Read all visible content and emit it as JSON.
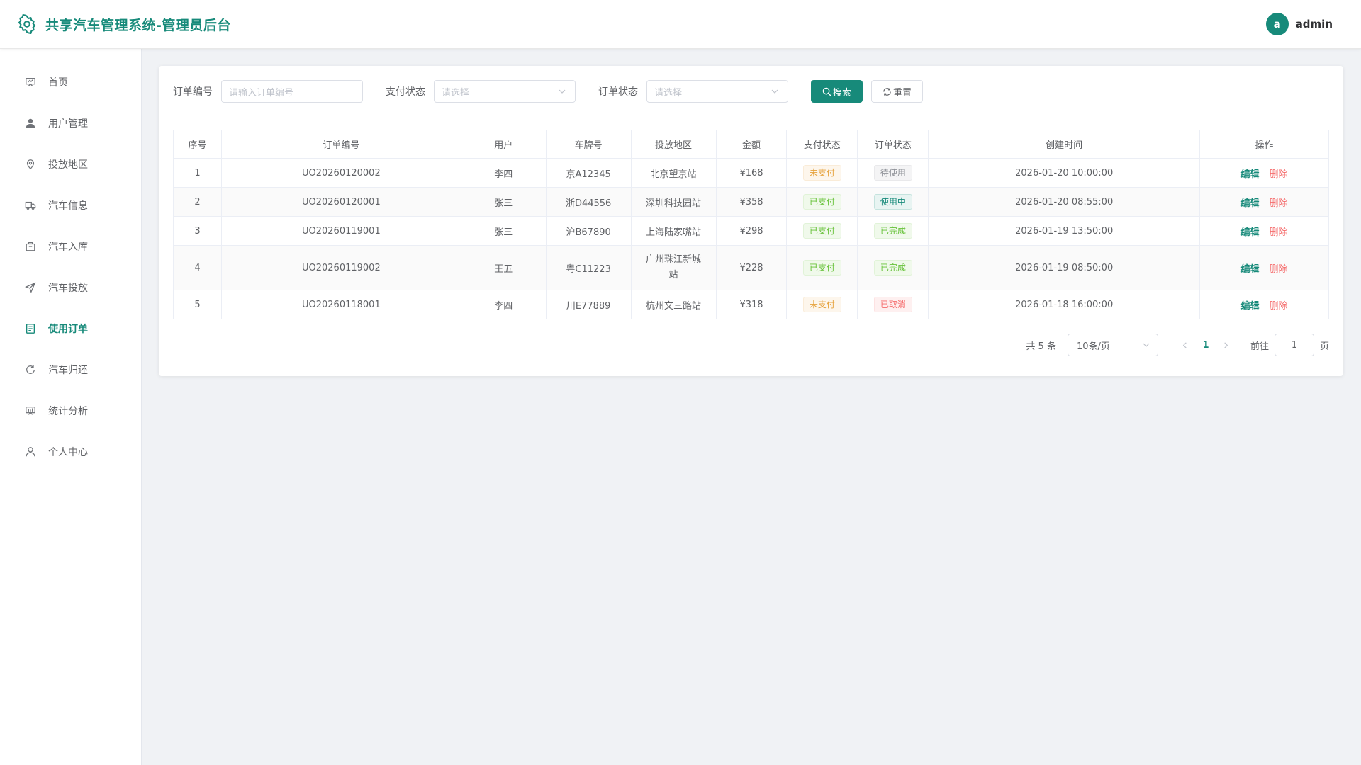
{
  "header": {
    "title": "共享汽车管理系统-管理员后台",
    "avatar_letter": "a",
    "username": "admin"
  },
  "sidebar": {
    "items": [
      {
        "label": "首页",
        "icon": "dashboard-icon"
      },
      {
        "label": "用户管理",
        "icon": "user-icon"
      },
      {
        "label": "投放地区",
        "icon": "location-icon"
      },
      {
        "label": "汽车信息",
        "icon": "truck-icon"
      },
      {
        "label": "汽车入库",
        "icon": "box-icon"
      },
      {
        "label": "汽车投放",
        "icon": "send-icon"
      },
      {
        "label": "使用订单",
        "icon": "document-icon"
      },
      {
        "label": "汽车归还",
        "icon": "refresh-icon"
      },
      {
        "label": "统计分析",
        "icon": "chart-icon"
      },
      {
        "label": "个人中心",
        "icon": "user-outline-icon"
      }
    ],
    "active_index": 6
  },
  "filters": {
    "order_no_label": "订单编号",
    "order_no_placeholder": "请输入订单编号",
    "pay_status_label": "支付状态",
    "pay_status_placeholder": "请选择",
    "order_status_label": "订单状态",
    "order_status_placeholder": "请选择",
    "search_label": "搜索",
    "reset_label": "重置"
  },
  "table": {
    "headers": [
      "序号",
      "订单编号",
      "用户",
      "车牌号",
      "投放地区",
      "金额",
      "支付状态",
      "订单状态",
      "创建时间",
      "操作"
    ],
    "rows": [
      {
        "idx": "1",
        "order_no": "UO20260120002",
        "user": "李四",
        "plate": "京A12345",
        "region": "北京望京站",
        "amount": "¥168",
        "pay": "未支付",
        "status": "待使用",
        "created": "2026-01-20 10:00:00"
      },
      {
        "idx": "2",
        "order_no": "UO20260120001",
        "user": "张三",
        "plate": "浙D44556",
        "region": "深圳科技园站",
        "amount": "¥358",
        "pay": "已支付",
        "status": "使用中",
        "created": "2026-01-20 08:55:00"
      },
      {
        "idx": "3",
        "order_no": "UO20260119001",
        "user": "张三",
        "plate": "沪B67890",
        "region": "上海陆家嘴站",
        "amount": "¥298",
        "pay": "已支付",
        "status": "已完成",
        "created": "2026-01-19 13:50:00"
      },
      {
        "idx": "4",
        "order_no": "UO20260119002",
        "user": "王五",
        "plate": "粤C11223",
        "region": "广州珠江新城站",
        "amount": "¥228",
        "pay": "已支付",
        "status": "已完成",
        "created": "2026-01-19 08:50:00"
      },
      {
        "idx": "5",
        "order_no": "UO20260118001",
        "user": "李四",
        "plate": "川E77889",
        "region": "杭州文三路站",
        "amount": "¥318",
        "pay": "未支付",
        "status": "已取消",
        "created": "2026-01-18 16:00:00"
      }
    ],
    "edit_label": "编辑",
    "delete_label": "删除"
  },
  "pagination": {
    "total_text": "共 5 条",
    "page_size": "10条/页",
    "current_page": "1",
    "goto_label": "前往",
    "goto_value": "1",
    "page_suffix": "页"
  },
  "colors": {
    "accent": "#178a7a",
    "danger": "#f56c6c",
    "warning": "#e6a23c",
    "success": "#67c23a"
  }
}
